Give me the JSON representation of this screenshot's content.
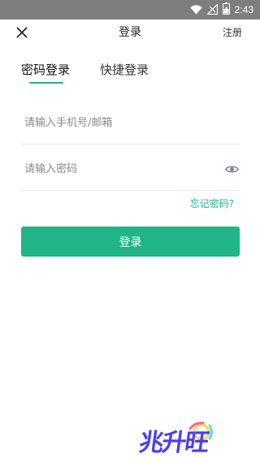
{
  "status_bar": {
    "time": "2:43",
    "icons": [
      "wifi-icon",
      "signal-icon",
      "battery-icon"
    ]
  },
  "header": {
    "title": "登录",
    "register_label": "注册",
    "close_icon": "close-icon"
  },
  "tabs": [
    {
      "label": "密码登录",
      "active": true
    },
    {
      "label": "快捷登录",
      "active": false
    }
  ],
  "form": {
    "phone_placeholder": "请输入手机号/邮箱",
    "phone_value": "",
    "password_placeholder": "请输入密码",
    "password_value": "",
    "eye_icon": "eye-icon",
    "forgot_label": "忘记密码?",
    "login_label": "登录"
  },
  "watermark": {
    "text": "兆升旺"
  },
  "colors": {
    "accent": "#21b486",
    "status_bar": "#7e7e7e",
    "watermark": "#4a3cf5"
  }
}
